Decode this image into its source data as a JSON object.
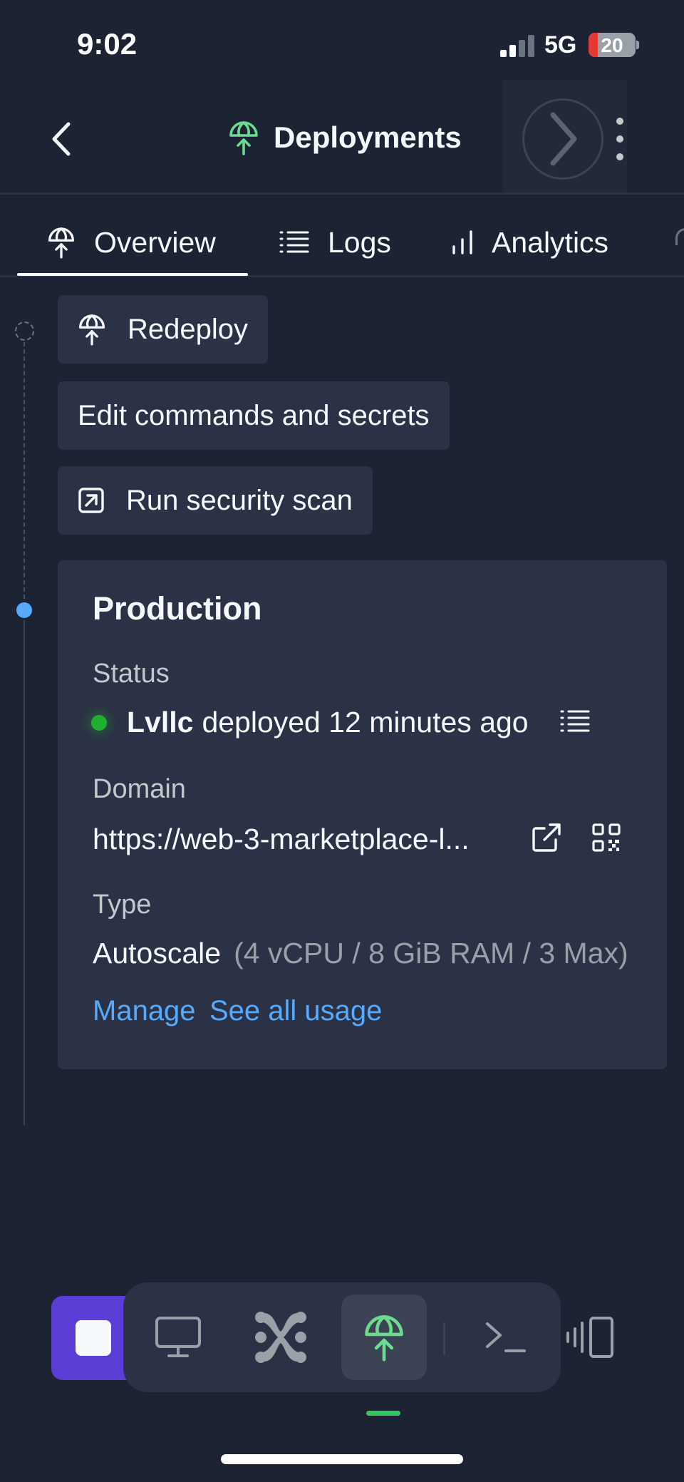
{
  "status_bar": {
    "time": "9:02",
    "network": "5G",
    "battery": "20",
    "battery_level_percent": 20
  },
  "header": {
    "title": "Deployments",
    "accent_color": "#6bdc8f"
  },
  "tabs": [
    {
      "label": "Overview",
      "icon": "deploy-icon",
      "active": true
    },
    {
      "label": "Logs",
      "icon": "list-icon",
      "active": false
    },
    {
      "label": "Analytics",
      "icon": "bar-chart-icon",
      "active": false
    }
  ],
  "actions": {
    "redeploy": "Redeploy",
    "edit_commands": "Edit commands and secrets",
    "security_scan": "Run security scan"
  },
  "production": {
    "title": "Production",
    "status_label": "Status",
    "status_user": "Lvllc",
    "status_text": "deployed 12 minutes ago",
    "status_color": "#1fb030",
    "domain_label": "Domain",
    "domain_value": "https://web-3-marketplace-l...",
    "type_label": "Type",
    "type_value": "Autoscale",
    "type_detail": "(4 vCPU / 8 GiB RAM / 3 Max)",
    "manage_link": "Manage",
    "usage_link": "See all usage",
    "link_color": "#57abff"
  },
  "dock": {
    "items": [
      "stop-icon",
      "desktop-icon",
      "workflow-icon",
      "deploy-icon",
      "terminal-icon",
      "devices-icon"
    ],
    "active_item": "deploy-icon",
    "stop_color": "#5b3ed6"
  }
}
